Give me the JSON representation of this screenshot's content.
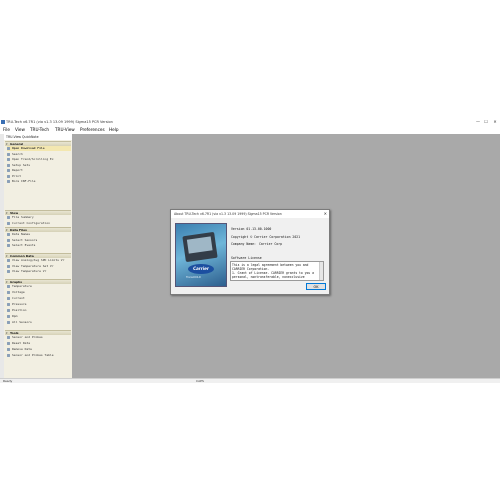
{
  "window": {
    "title": "TRU-Tech v6.7R1 (via v1.3 13.09 1999) Sigma15 PCR Version",
    "controls": {
      "minimize": "—",
      "maximize": "☐",
      "close": "✕"
    }
  },
  "menubar": [
    "File",
    "View",
    "TRU-Tech",
    "TRU-View",
    "Preferences",
    "Help"
  ],
  "panel": {
    "header": "TRU-View QuickNote",
    "sections": [
      {
        "title": "General",
        "items": [
          "Open Download File",
          "Search",
          "Open Trend/Scrolling Ex",
          "Setup Sets",
          "Report",
          "Print",
          "Bore INF-File"
        ]
      },
      {
        "title": "View",
        "items": [
          "File Summary",
          "Current Configuration"
        ]
      },
      {
        "title": "Data Files",
        "items": [
          "Data Names",
          "Select Sensors",
          "Select Events"
        ]
      },
      {
        "title": "Common Data",
        "items": [
          "View Analog/Avg SPD Limits Vr",
          "View Temperature Set Vr",
          "View Temperature Vr"
        ]
      },
      {
        "title": "Graphs",
        "items": [
          "Temperature",
          "Voltage",
          "Current",
          "Pressure",
          "Position",
          "Rpm",
          "All Sensors"
        ]
      },
      {
        "title": "Tools",
        "items": [
          "Sensor and Probes",
          "Reset Data",
          "Remove Data",
          "Sensor and Probes Table"
        ]
      }
    ],
    "selected_item": "Open Download File"
  },
  "statusbar": {
    "left": "Ready",
    "middle": "",
    "right": "CAPS"
  },
  "dialog": {
    "title": "About TRU-Tech v6.7R1 (via v1.3 13.09 1999) Sigma15 PCR Version",
    "close": "✕",
    "version": "Version 01.13.00.1000",
    "copyright": "Copyright © Carrier Corporation 2021",
    "company_label": "Company Name:",
    "company_value": "Carrier Corp",
    "license_heading": "Software License",
    "license_lines": [
      "This is a legal agreement between you and",
      "CARRIER Corporation.",
      "",
      "Software License",
      "",
      "1. Grant of License. CARRIER grants to you a",
      "personal, nontransferable, nonexclusive"
    ],
    "ok_label": "OK",
    "brand_logo": "Carrier",
    "brand_sub": "TransiCOLD"
  },
  "colors": {
    "mdi_background": "#a9a9a9",
    "panel_background": "#f2efe2",
    "section_background": "#d6d1b6",
    "accent": "#0078d7"
  }
}
